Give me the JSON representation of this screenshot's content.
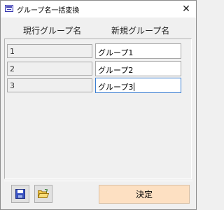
{
  "window": {
    "title": "グループ名一括変換",
    "close_glyph": "✕"
  },
  "columns": {
    "current": "現行グループ名",
    "new": "新規グループ名"
  },
  "rows": [
    {
      "current": "1",
      "new": "グループ1"
    },
    {
      "current": "2",
      "new": "グループ2"
    },
    {
      "current": "3",
      "new": "グループ3"
    }
  ],
  "footer": {
    "save_icon": "save-icon",
    "open_icon": "open-folder-icon",
    "ok_label": "決定"
  },
  "colors": {
    "ok_button_bg": "#fde0c2",
    "focus_border": "#3c7fd1"
  }
}
